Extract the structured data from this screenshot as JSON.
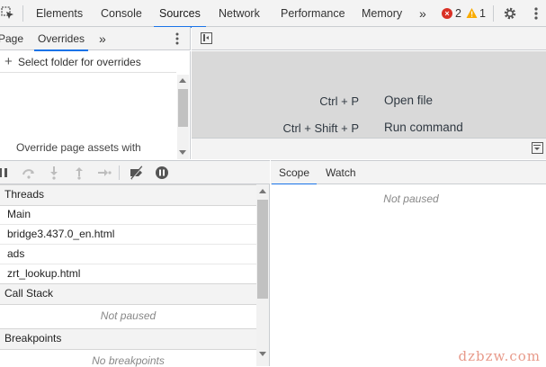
{
  "top_tabs": [
    "Elements",
    "Console",
    "Sources",
    "Network",
    "Performance",
    "Memory"
  ],
  "active_top_tab": "Sources",
  "more_tabs_glyph": "»",
  "errors": {
    "count": "2",
    "color": "#d93025"
  },
  "warnings": {
    "count": "1",
    "color": "#f9ab00"
  },
  "navigator": {
    "tabs": [
      "Page",
      "Overrides"
    ],
    "active": "Overrides",
    "more_glyph": "»",
    "select_folder": "Select folder for overrides",
    "override_text": "Override page assets with"
  },
  "editor": {
    "shortcuts": [
      {
        "keys": "Ctrl + P",
        "action": "Open file"
      },
      {
        "keys": "Ctrl + Shift + P",
        "action": "Run command"
      }
    ]
  },
  "sidebar": {
    "threads": {
      "title": "Threads",
      "items": [
        "Main",
        "bridge3.437.0_en.html",
        "ads",
        "zrt_lookup.html"
      ]
    },
    "call_stack": {
      "title": "Call Stack",
      "empty": "Not paused"
    },
    "breakpoints": {
      "title": "Breakpoints",
      "empty": "No breakpoints"
    }
  },
  "scope": {
    "tabs": [
      "Scope",
      "Watch"
    ],
    "active": "Scope",
    "empty": "Not paused"
  },
  "watermark": "dzbzw.com",
  "accent_color": "#1a73e8"
}
